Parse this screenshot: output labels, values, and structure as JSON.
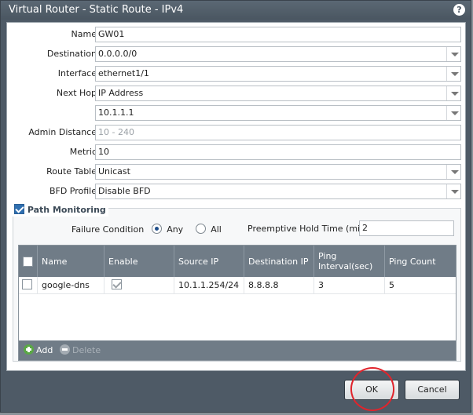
{
  "dialog": {
    "title": "Virtual Router - Static Route - IPv4",
    "help_label": "?"
  },
  "form": {
    "name": {
      "label": "Name",
      "value": "GW01"
    },
    "destination": {
      "label": "Destination",
      "value": "0.0.0.0/0"
    },
    "interface": {
      "label": "Interface",
      "value": "ethernet1/1"
    },
    "next_hop": {
      "label": "Next Hop",
      "value": "IP Address"
    },
    "next_hop_ip": {
      "value": "10.1.1.1"
    },
    "admin_distance": {
      "label": "Admin Distance",
      "placeholder": "10 - 240"
    },
    "metric": {
      "label": "Metric",
      "value": "10"
    },
    "route_table": {
      "label": "Route Table",
      "value": "Unicast"
    },
    "bfd_profile": {
      "label": "BFD Profile",
      "value": "Disable BFD"
    }
  },
  "path_monitoring": {
    "label": "Path Monitoring",
    "checked": true,
    "failure_condition_label": "Failure Condition",
    "option_any": "Any",
    "option_all": "All",
    "selected": "Any",
    "preemptive_label": "Preemptive Hold Time (min)",
    "preemptive_value": "2",
    "table": {
      "columns": [
        "Name",
        "Enable",
        "Source IP",
        "Destination IP",
        "Ping Interval(sec)",
        "Ping Count"
      ],
      "rows": [
        {
          "name": "google-dns",
          "enable": true,
          "source_ip": "10.1.1.254/24",
          "destination_ip": "8.8.8.8",
          "ping_interval": "3",
          "ping_count": "5"
        }
      ]
    },
    "add_label": "Add",
    "delete_label": "Delete"
  },
  "buttons": {
    "ok": "OK",
    "cancel": "Cancel"
  },
  "colors": {
    "frame": "#4e5a66",
    "grid_header": "#707c87",
    "annotation": "#e0242c"
  }
}
